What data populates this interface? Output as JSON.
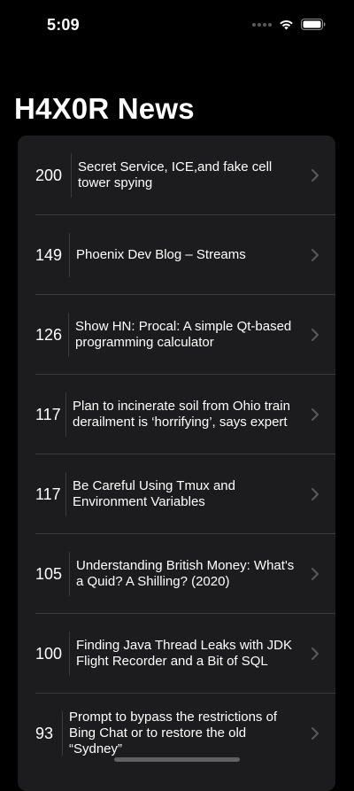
{
  "status_bar": {
    "time": "5:09",
    "icons": [
      "signal-dots-icon",
      "wifi-icon",
      "battery-icon"
    ]
  },
  "page": {
    "title": "H4X0R News"
  },
  "colors": {
    "background": "#000000",
    "card": "#1c1c1e",
    "separator": "#3a3a3c",
    "chevron": "#5a5a5e",
    "text": "#ffffff"
  },
  "stories": [
    {
      "score": "200",
      "title": "Secret Service, ICE,and fake cell tower spying"
    },
    {
      "score": "149",
      "title": "Phoenix Dev Blog – Streams"
    },
    {
      "score": "126",
      "title": "Show HN: Procal: A simple Qt-based programming calculator"
    },
    {
      "score": "117",
      "title": "Plan to incinerate soil from Ohio train derailment is ‘horrifying’, says expert"
    },
    {
      "score": "117",
      "title": "Be Careful Using Tmux and Environment Variables"
    },
    {
      "score": "105",
      "title": "Understanding British Money: What's a Quid? A Shilling? (2020)"
    },
    {
      "score": "100",
      "title": "Finding Java Thread Leaks with JDK Flight Recorder and a Bit of SQL"
    },
    {
      "score": "93",
      "title": "Prompt to bypass the restrictions of Bing Chat or to restore the old “Sydney”"
    }
  ]
}
